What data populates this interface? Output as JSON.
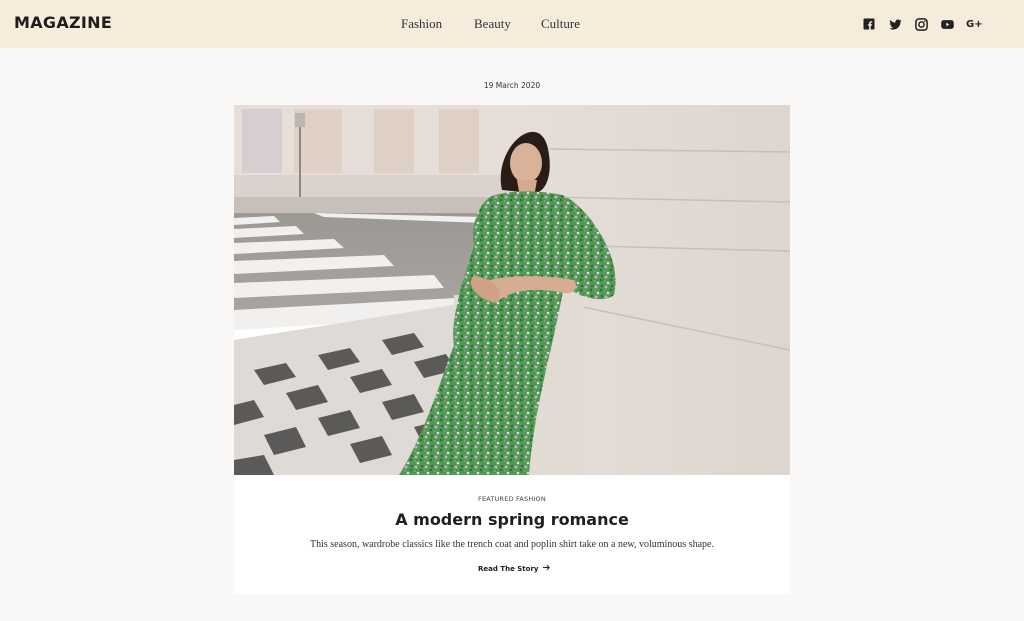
{
  "header": {
    "logo": "MAGAZINE",
    "nav": [
      "Fashion",
      "Beauty",
      "Culture"
    ],
    "social_icons": [
      "facebook-icon",
      "twitter-icon",
      "instagram-icon",
      "youtube-icon",
      "google-plus-icon"
    ],
    "google_plus_text": "G+",
    "background": "#f5ecdc"
  },
  "article": {
    "date": "19 March 2020",
    "category": "FEATURED FASHION",
    "title": "A modern spring romance",
    "excerpt": "This season, wardrobe classics like the trench coat and poplin shirt take on a new, voluminous shape.",
    "cta": "Read The Story"
  },
  "colors": {
    "page_bg": "#f9f8f6",
    "card_bg": "#ffffff",
    "text": "#222222"
  }
}
